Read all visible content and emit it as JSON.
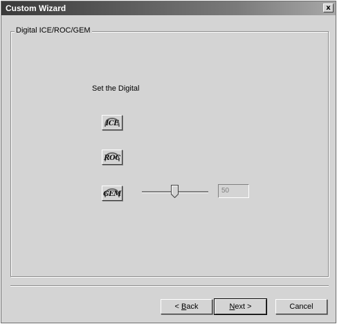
{
  "window": {
    "title": "Custom Wizard",
    "close_glyph": "x"
  },
  "group": {
    "label": "Digital ICE/ROC/GEM",
    "instruction": "Set the Digital"
  },
  "options": {
    "ice": {
      "label": "ICE",
      "icon": "ice-icon"
    },
    "roc": {
      "label": "ROC",
      "icon": "roc-icon"
    },
    "gem": {
      "label": "GEM",
      "icon": "gem-icon"
    }
  },
  "gem_slider": {
    "value": 50,
    "value_text": "50",
    "min": 0,
    "max": 100,
    "enabled": false
  },
  "buttons": {
    "back": {
      "prefix": "< ",
      "accel": "B",
      "rest": "ack"
    },
    "next": {
      "accel": "N",
      "rest": "ext >"
    },
    "cancel": "Cancel"
  },
  "colors": {
    "face": "#d4d4d4",
    "title_bar": "#3a3a3a"
  }
}
